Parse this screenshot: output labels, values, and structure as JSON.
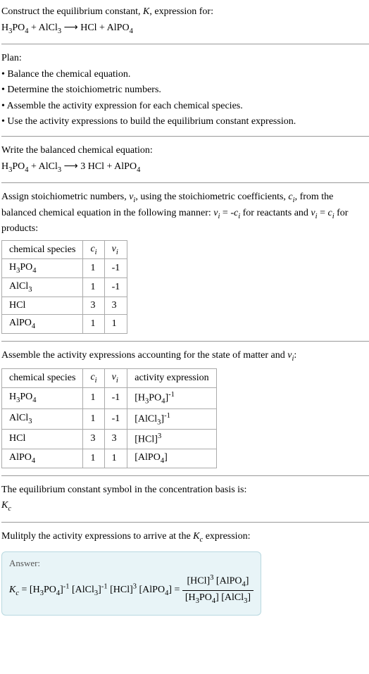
{
  "header": {
    "title": "Construct the equilibrium constant, <i>K</i>, expression for:",
    "equation": "H<sub>3</sub>PO<sub>4</sub> + AlCl<sub>3</sub> ⟶ HCl + AlPO<sub>4</sub>"
  },
  "plan": {
    "title": "Plan:",
    "items": [
      "• Balance the chemical equation.",
      "• Determine the stoichiometric numbers.",
      "• Assemble the activity expression for each chemical species.",
      "• Use the activity expressions to build the equilibrium constant expression."
    ]
  },
  "balanced": {
    "title": "Write the balanced chemical equation:",
    "equation": "H<sub>3</sub>PO<sub>4</sub> + AlCl<sub>3</sub> ⟶ 3 HCl + AlPO<sub>4</sub>"
  },
  "stoich": {
    "intro": "Assign stoichiometric numbers, <i>ν<sub>i</sub></i>, using the stoichiometric coefficients, <i>c<sub>i</sub></i>, from the balanced chemical equation in the following manner: <i>ν<sub>i</sub></i> = -<i>c<sub>i</sub></i> for reactants and <i>ν<sub>i</sub></i> = <i>c<sub>i</sub></i> for products:",
    "headers": [
      "chemical species",
      "<i>c<sub>i</sub></i>",
      "<i>ν<sub>i</sub></i>"
    ],
    "rows": [
      [
        "H<sub>3</sub>PO<sub>4</sub>",
        "1",
        "-1"
      ],
      [
        "AlCl<sub>3</sub>",
        "1",
        "-1"
      ],
      [
        "HCl",
        "3",
        "3"
      ],
      [
        "AlPO<sub>4</sub>",
        "1",
        "1"
      ]
    ]
  },
  "activity": {
    "intro": "Assemble the activity expressions accounting for the state of matter and <i>ν<sub>i</sub></i>:",
    "headers": [
      "chemical species",
      "<i>c<sub>i</sub></i>",
      "<i>ν<sub>i</sub></i>",
      "activity expression"
    ],
    "rows": [
      [
        "H<sub>3</sub>PO<sub>4</sub>",
        "1",
        "-1",
        "[H<sub>3</sub>PO<sub>4</sub>]<sup>-1</sup>"
      ],
      [
        "AlCl<sub>3</sub>",
        "1",
        "-1",
        "[AlCl<sub>3</sub>]<sup>-1</sup>"
      ],
      [
        "HCl",
        "3",
        "3",
        "[HCl]<sup>3</sup>"
      ],
      [
        "AlPO<sub>4</sub>",
        "1",
        "1",
        "[AlPO<sub>4</sub>]"
      ]
    ]
  },
  "symbol": {
    "line1": "The equilibrium constant symbol in the concentration basis is:",
    "line2": "<i>K<sub>c</sub></i>"
  },
  "multiply": {
    "intro": "Mulitply the activity expressions to arrive at the <i>K<sub>c</sub></i> expression:",
    "answer_label": "Answer:",
    "expr_lhs": "<i>K<sub>c</sub></i> = [H<sub>3</sub>PO<sub>4</sub>]<sup>-1</sup> [AlCl<sub>3</sub>]<sup>-1</sup> [HCl]<sup>3</sup> [AlPO<sub>4</sub>] = ",
    "frac_num": "[HCl]<sup>3</sup> [AlPO<sub>4</sub>]",
    "frac_den": "[H<sub>3</sub>PO<sub>4</sub>] [AlCl<sub>3</sub>]"
  },
  "chart_data": {
    "type": "table",
    "tables": [
      {
        "title": "Stoichiometric numbers",
        "columns": [
          "chemical species",
          "c_i",
          "ν_i"
        ],
        "rows": [
          [
            "H3PO4",
            1,
            -1
          ],
          [
            "AlCl3",
            1,
            -1
          ],
          [
            "HCl",
            3,
            3
          ],
          [
            "AlPO4",
            1,
            1
          ]
        ]
      },
      {
        "title": "Activity expressions",
        "columns": [
          "chemical species",
          "c_i",
          "ν_i",
          "activity expression"
        ],
        "rows": [
          [
            "H3PO4",
            1,
            -1,
            "[H3PO4]^-1"
          ],
          [
            "AlCl3",
            1,
            -1,
            "[AlCl3]^-1"
          ],
          [
            "HCl",
            3,
            3,
            "[HCl]^3"
          ],
          [
            "AlPO4",
            1,
            1,
            "[AlPO4]"
          ]
        ]
      }
    ]
  }
}
